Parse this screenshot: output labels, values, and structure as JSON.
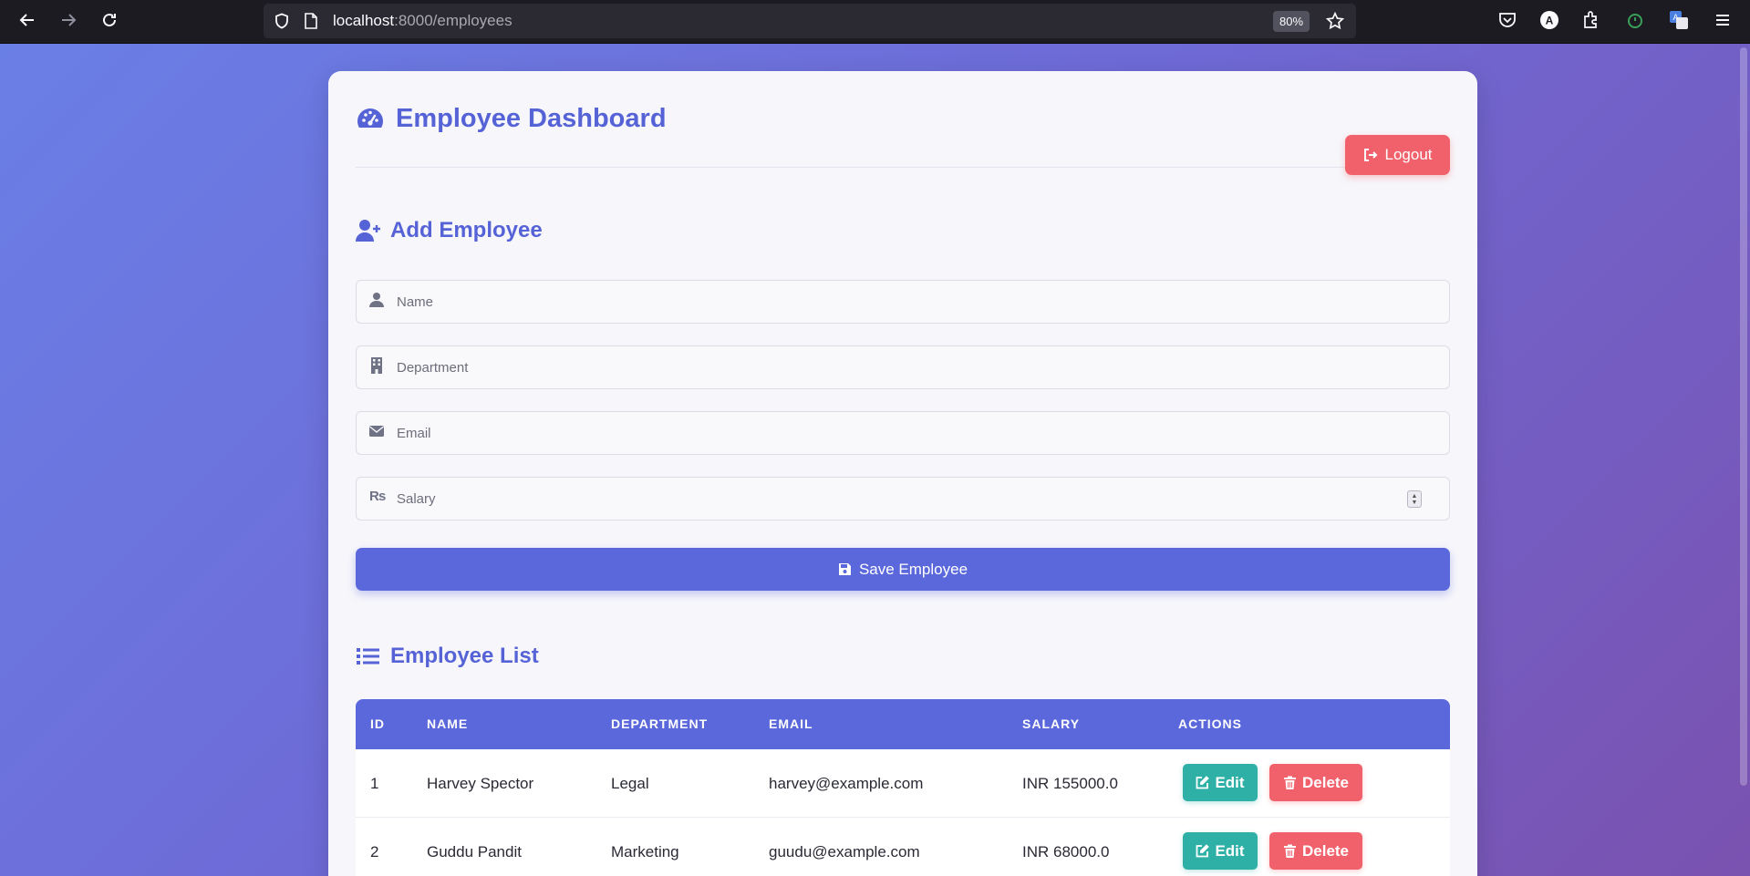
{
  "browser": {
    "url_host": "localhost",
    "url_path": ":8000/employees",
    "zoom": "80%"
  },
  "header": {
    "title": "Employee Dashboard",
    "logout_label": "Logout"
  },
  "form": {
    "title": "Add Employee",
    "name_placeholder": "Name",
    "department_placeholder": "Department",
    "email_placeholder": "Email",
    "salary_placeholder": "Salary",
    "currency_symbol": "₨",
    "save_label": "Save Employee"
  },
  "list": {
    "title": "Employee List",
    "columns": [
      "ID",
      "NAME",
      "DEPARTMENT",
      "EMAIL",
      "SALARY",
      "ACTIONS"
    ],
    "rows": [
      {
        "id": "1",
        "name": "Harvey Spector",
        "department": "Legal",
        "email": "harvey@example.com",
        "salary": "INR 155000.0"
      },
      {
        "id": "2",
        "name": "Guddu Pandit",
        "department": "Marketing",
        "email": "guudu@example.com",
        "salary": "INR 68000.0"
      }
    ],
    "edit_label": "Edit",
    "delete_label": "Delete"
  },
  "colors": {
    "primary": "#5b68db",
    "danger": "#f1616b",
    "success": "#2fb0a7"
  },
  "icons": {
    "title": "tachometer-icon",
    "add": "user-plus-icon",
    "list": "list-icon",
    "name_field": "user-icon",
    "department_field": "building-icon",
    "email_field": "envelope-icon",
    "save": "floppy-disk-icon",
    "edit": "edit-icon",
    "delete": "trash-icon"
  }
}
